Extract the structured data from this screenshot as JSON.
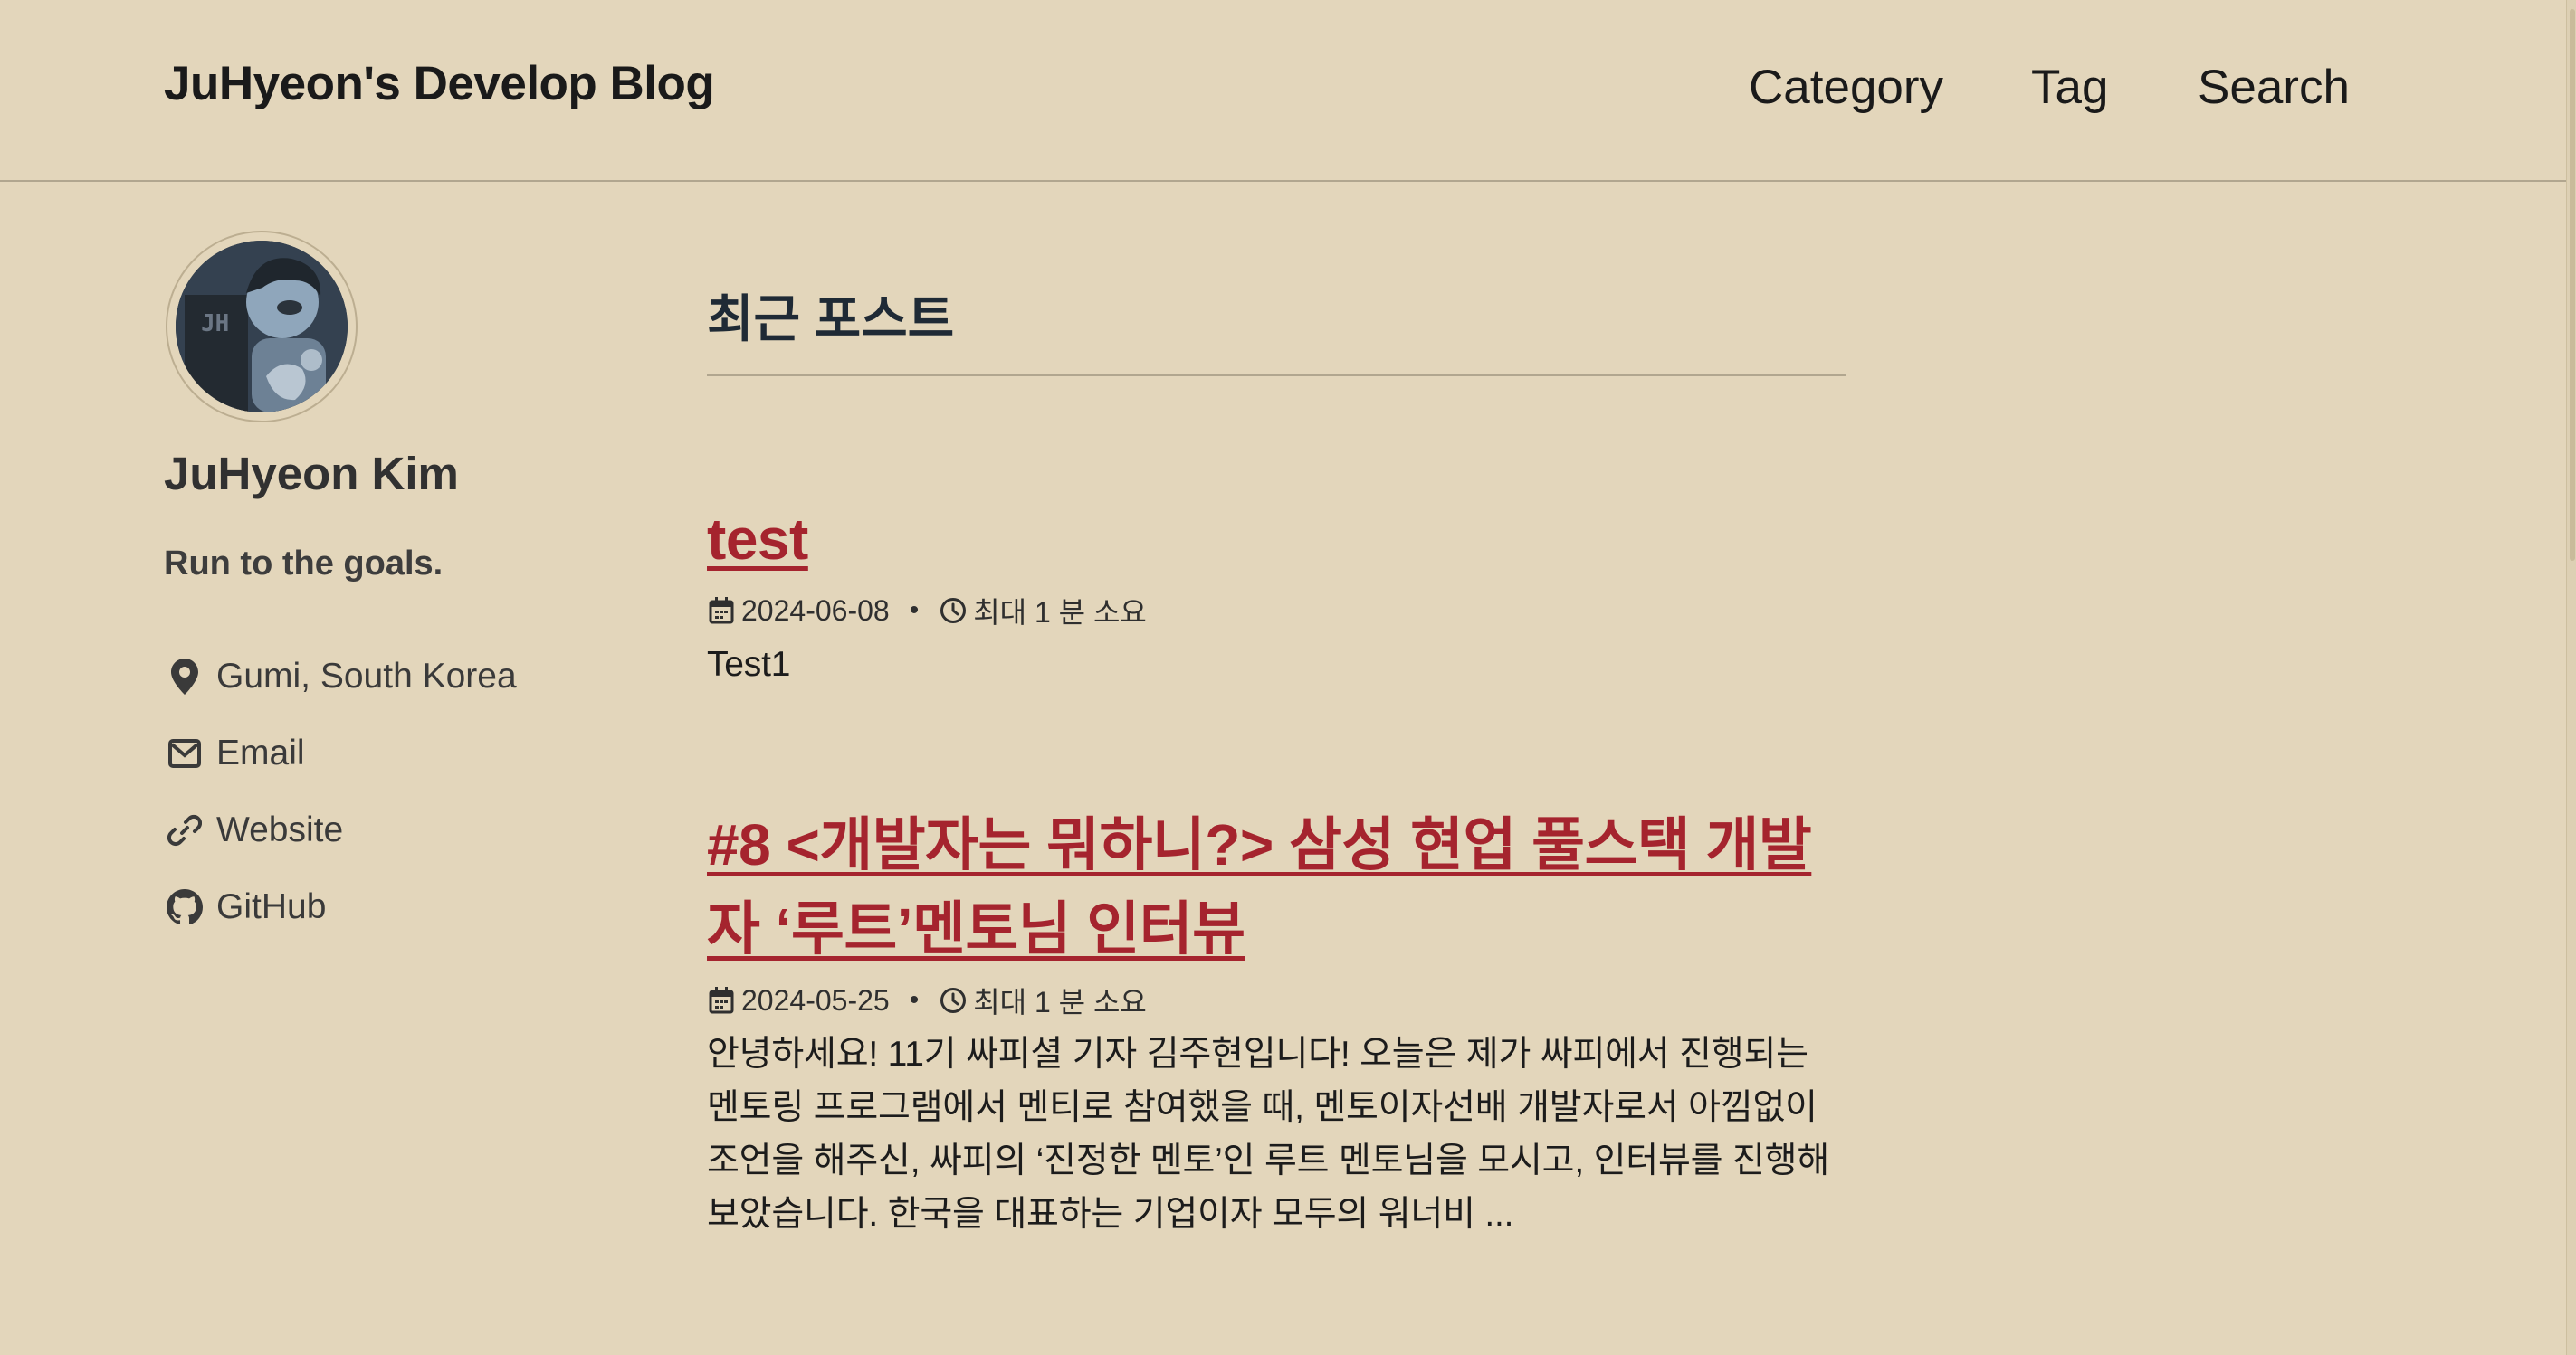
{
  "site": {
    "title": "JuHyeon's Develop Blog"
  },
  "nav": {
    "items": [
      "Category",
      "Tag",
      "Search"
    ]
  },
  "author": {
    "name": "JuHyeon Kim",
    "bio": "Run to the goals.",
    "links": [
      {
        "label": "Gumi, South Korea",
        "icon": "map-marker-icon"
      },
      {
        "label": "Email",
        "icon": "envelope-icon"
      },
      {
        "label": "Website",
        "icon": "link-icon"
      },
      {
        "label": "GitHub",
        "icon": "github-icon"
      }
    ]
  },
  "main": {
    "section_title": "최근 포스트",
    "posts": [
      {
        "title": "test",
        "date": "2024-06-08",
        "read_time": "최대 1 분 소요",
        "excerpt": "Test1"
      },
      {
        "title": "#8 <개발자는 뭐하니?> 삼성 현업 풀스택 개발자 ‘루트’멘토님 인터뷰",
        "date": "2024-05-25",
        "read_time": "최대 1 분 소요",
        "excerpt": "안녕하세요! 11기 싸피셜 기자 김주현입니다! 오늘은 제가 싸피에서 진행되는 멘토링 프로그램에서 멘티로 참여했을 때, 멘토이자선배 개발자로서 아낌없이 조언을 해주신, 싸피의 ‘진정한 멘토’인 루트 멘토님을 모시고, 인터뷰를 진행해보았습니다. 한국을 대표하는 기업이자 모두의 워너비 ..."
      }
    ]
  },
  "colors": {
    "background": "#e3d6bb",
    "post_title": "#a5242e",
    "text": "#313131"
  }
}
